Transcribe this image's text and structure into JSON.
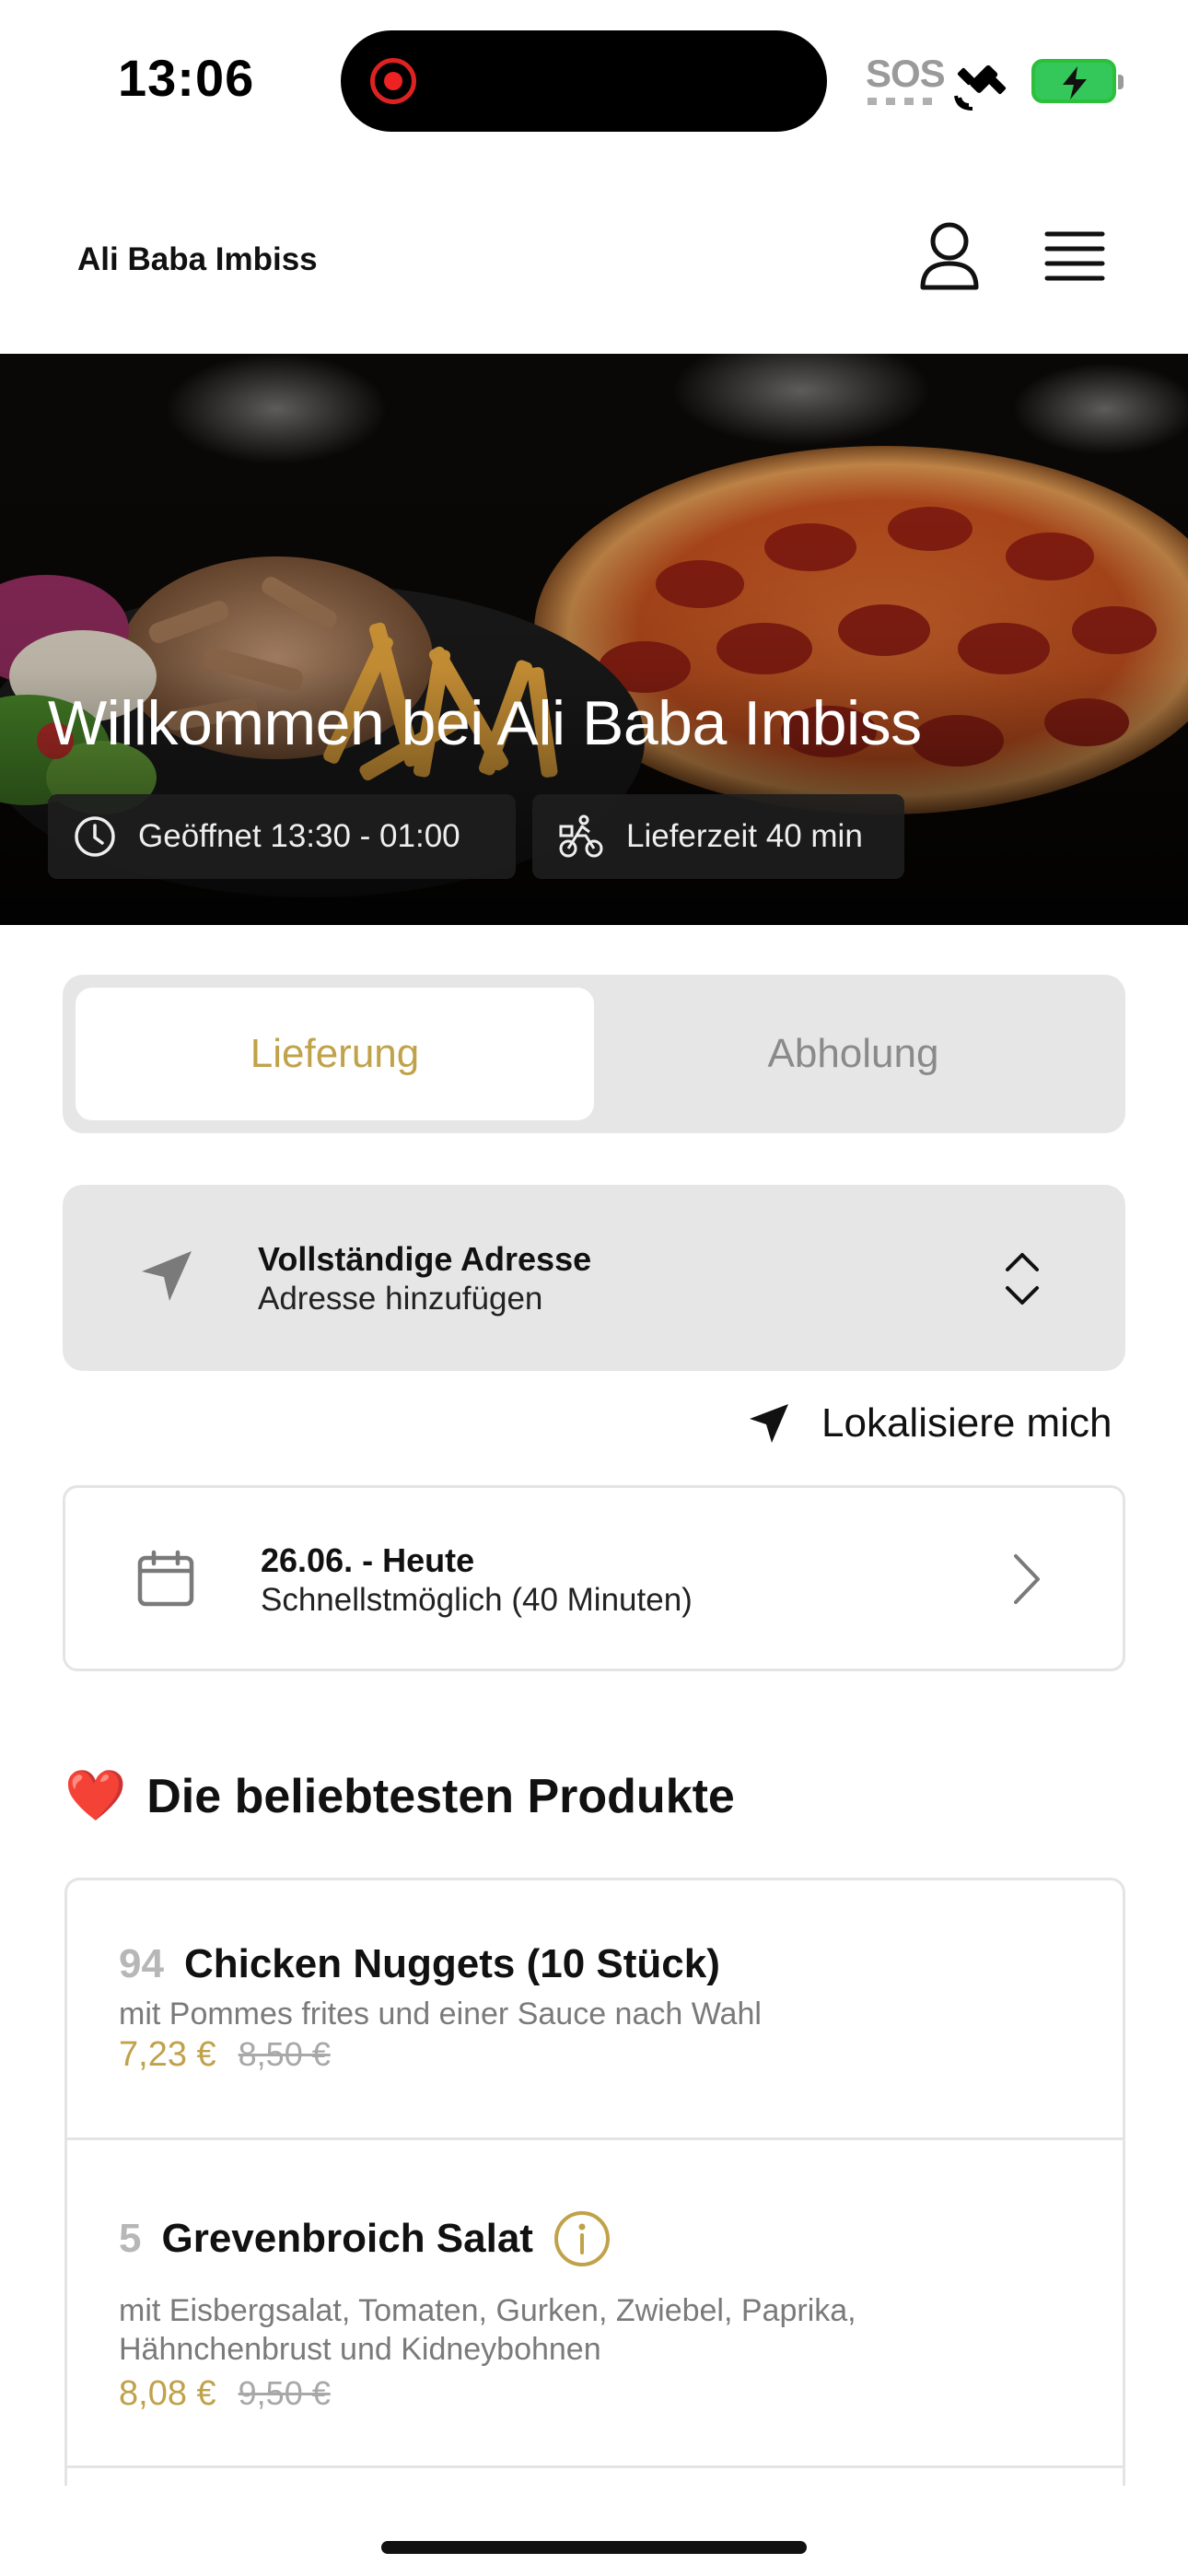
{
  "status_bar": {
    "time": "13:06",
    "sos": "SOS",
    "icons": [
      "screen-recording-icon",
      "satellite-icon",
      "battery-charging-icon"
    ]
  },
  "header": {
    "brand": "Ali Baba Imbiss",
    "icons": [
      "user-icon",
      "menu-icon"
    ]
  },
  "hero": {
    "title": "Willkommen bei Ali Baba Imbiss",
    "open_hours": "Geöffnet 13:30 - 01:00",
    "delivery_time": "Lieferzeit 40 min"
  },
  "order_mode": {
    "tabs": [
      {
        "label": "Lieferung",
        "active": true
      },
      {
        "label": "Abholung",
        "active": false
      }
    ]
  },
  "address": {
    "title": "Vollständige Adresse",
    "subtitle": "Adresse hinzufügen",
    "locate_label": "Lokalisiere mich"
  },
  "date": {
    "title": "26.06. - Heute",
    "subtitle": "Schnellstmöglich (40 Minuten)"
  },
  "popular": {
    "title": "Die beliebtesten Produkte",
    "emoji": "❤️",
    "products": [
      {
        "number": "94",
        "name": "Chicken Nuggets (10 Stück)",
        "description": "mit Pommes frites und einer Sauce nach Wahl",
        "price": "7,23 €",
        "old_price": "8,50 €",
        "has_info": false
      },
      {
        "number": "5",
        "name": "Grevenbroich Salat",
        "description_line1": "mit Eisbergsalat, Tomaten, Gurken, Zwiebel, Paprika,",
        "description_line2": "Hähnchenbrust und Kidneybohnen",
        "price": "8,08 €",
        "old_price": "9,50 €",
        "has_info": true
      }
    ]
  },
  "colors": {
    "accent": "#c0a24a",
    "toggle_bg": "#e6e6e6",
    "muted": "#8a8a8a"
  }
}
